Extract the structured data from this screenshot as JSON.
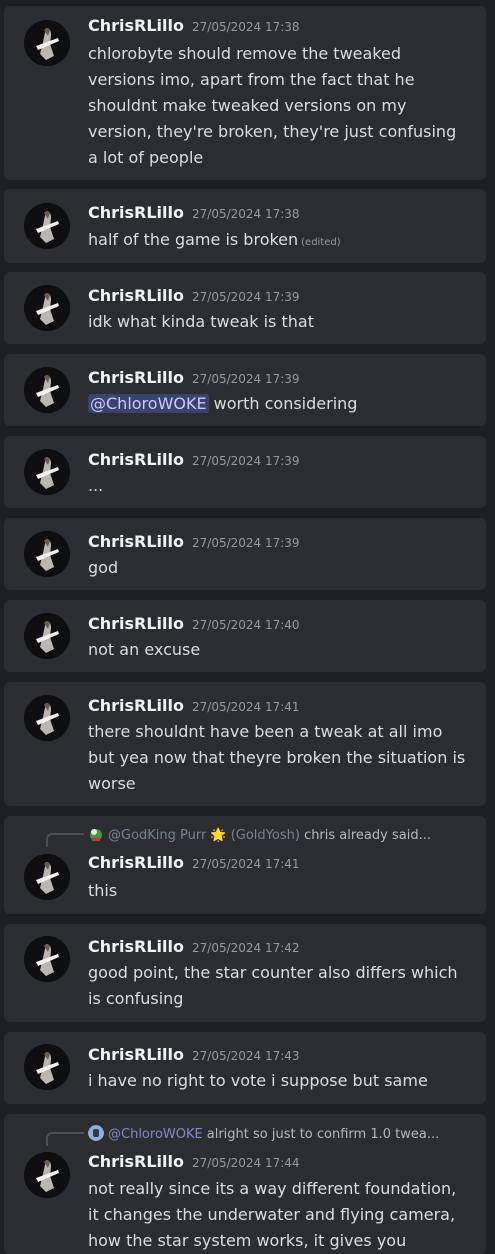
{
  "messages": [
    {
      "author": "ChrisRLillo",
      "timestamp": "27/05/2024 17:38",
      "text": "chlorobyte should remove the tweaked versions imo, apart from the fact that he shouldnt make tweaked versions on my version, they're broken, they're just confusing a lot of people"
    },
    {
      "author": "ChrisRLillo",
      "timestamp": "27/05/2024 17:38",
      "text": "half of the game is broken",
      "edited": "(edited)"
    },
    {
      "author": "ChrisRLillo",
      "timestamp": "27/05/2024 17:39",
      "text": "idk what kinda tweak is that"
    },
    {
      "author": "ChrisRLillo",
      "timestamp": "27/05/2024 17:39",
      "mention": "@ChloroWOKE",
      "text": " worth considering"
    },
    {
      "author": "ChrisRLillo",
      "timestamp": "27/05/2024 17:39",
      "text": "..."
    },
    {
      "author": "ChrisRLillo",
      "timestamp": "27/05/2024 17:39",
      "text": "god"
    },
    {
      "author": "ChrisRLillo",
      "timestamp": "27/05/2024 17:40",
      "text": "not an excuse"
    },
    {
      "author": "ChrisRLillo",
      "timestamp": "27/05/2024 17:41",
      "text": "there shouldnt have been a tweak at all imo but yea now that theyre broken the situation is worse"
    },
    {
      "author": "ChrisRLillo",
      "timestamp": "27/05/2024 17:41",
      "text": "this",
      "reply": {
        "name": "@GodKing Purr",
        "emoji": "🌟",
        "alias": "(GoldYosh)",
        "text": "chris already said..."
      }
    },
    {
      "author": "ChrisRLillo",
      "timestamp": "27/05/2024 17:42",
      "text": "good point, the star counter also differs which is confusing"
    },
    {
      "author": "ChrisRLillo",
      "timestamp": "27/05/2024 17:43",
      "text": "i have no right to vote i suppose but same"
    },
    {
      "author": "ChrisRLillo",
      "timestamp": "27/05/2024 17:44",
      "text": "not really since its a way different foundation, it changes the underwater and flying camera, how the star system works, it gives you",
      "reply": {
        "name": "@ChloroWOKE",
        "text": "alright so just to confirm 1.0 twea..."
      }
    }
  ]
}
